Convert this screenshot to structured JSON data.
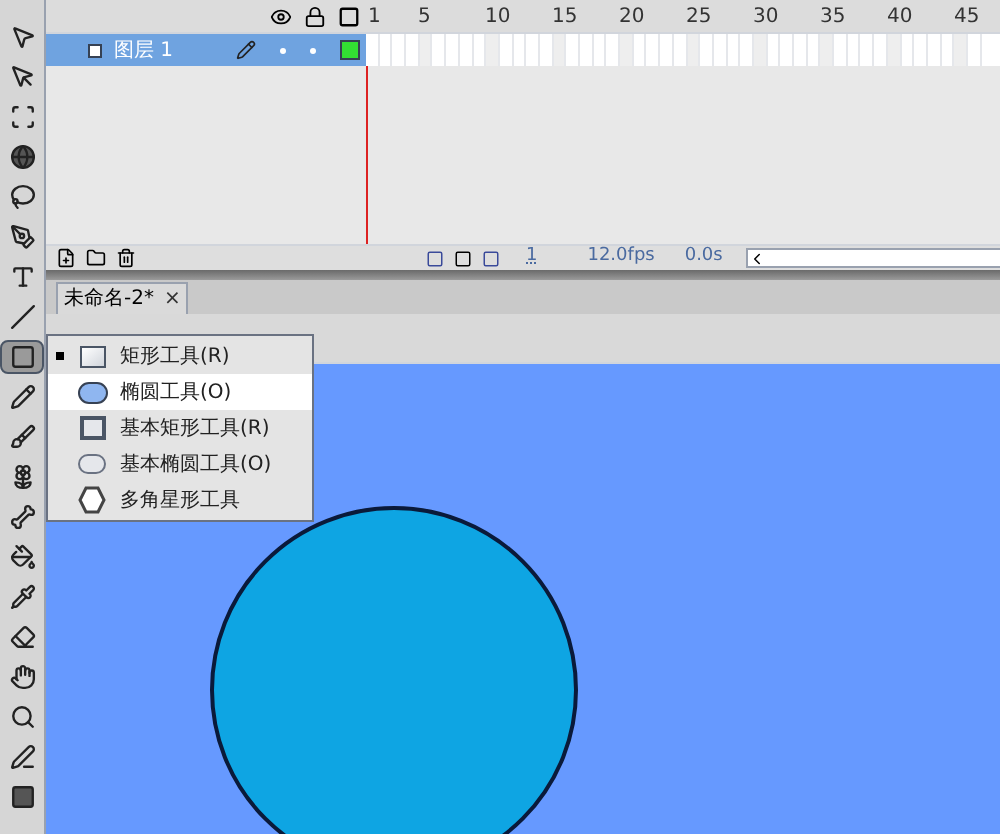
{
  "toolbar": {
    "tools": [
      {
        "kind": "arrow",
        "selected": false
      },
      {
        "kind": "subselect",
        "selected": false
      },
      {
        "kind": "transform",
        "selected": false
      },
      {
        "kind": "sphere",
        "selected": false
      },
      {
        "kind": "lasso",
        "selected": false
      },
      {
        "kind": "pen",
        "selected": false
      },
      {
        "kind": "text",
        "selected": false
      },
      {
        "kind": "line",
        "selected": false
      },
      {
        "kind": "rect",
        "selected": true
      },
      {
        "kind": "pencil",
        "selected": false
      },
      {
        "kind": "brush",
        "selected": false
      },
      {
        "kind": "deco",
        "selected": false
      },
      {
        "kind": "bone",
        "selected": false
      },
      {
        "kind": "bucket",
        "selected": false
      },
      {
        "kind": "eyedropper",
        "selected": false
      },
      {
        "kind": "eraser",
        "selected": false
      },
      {
        "kind": "hand",
        "selected": false
      },
      {
        "kind": "zoom",
        "selected": false
      },
      {
        "kind": "stroke",
        "selected": false
      },
      {
        "kind": "fill",
        "selected": false
      }
    ]
  },
  "timeline": {
    "frame_numbers": [
      "1",
      "5",
      "10",
      "15",
      "20",
      "25",
      "30",
      "35",
      "40",
      "45"
    ],
    "layers": [
      {
        "name": "图层 1",
        "selected": true
      }
    ],
    "status": {
      "current_frame": "1",
      "frame_rate": "12.0fps",
      "elapsed": "0.0s"
    }
  },
  "document_tab": {
    "title": "未命名-2*",
    "close": "×"
  },
  "tool_menu": {
    "items": [
      {
        "label": "矩形工具(R)",
        "kind": "rect",
        "checked": true,
        "selected": false
      },
      {
        "label": "椭圆工具(O)",
        "kind": "oval",
        "checked": false,
        "selected": true
      },
      {
        "label": "基本矩形工具(R)",
        "kind": "prim_rect",
        "checked": false,
        "selected": false
      },
      {
        "label": "基本椭圆工具(O)",
        "kind": "prim_oval",
        "checked": false,
        "selected": false
      },
      {
        "label": "多角星形工具",
        "kind": "polystar",
        "checked": false,
        "selected": false
      }
    ]
  }
}
